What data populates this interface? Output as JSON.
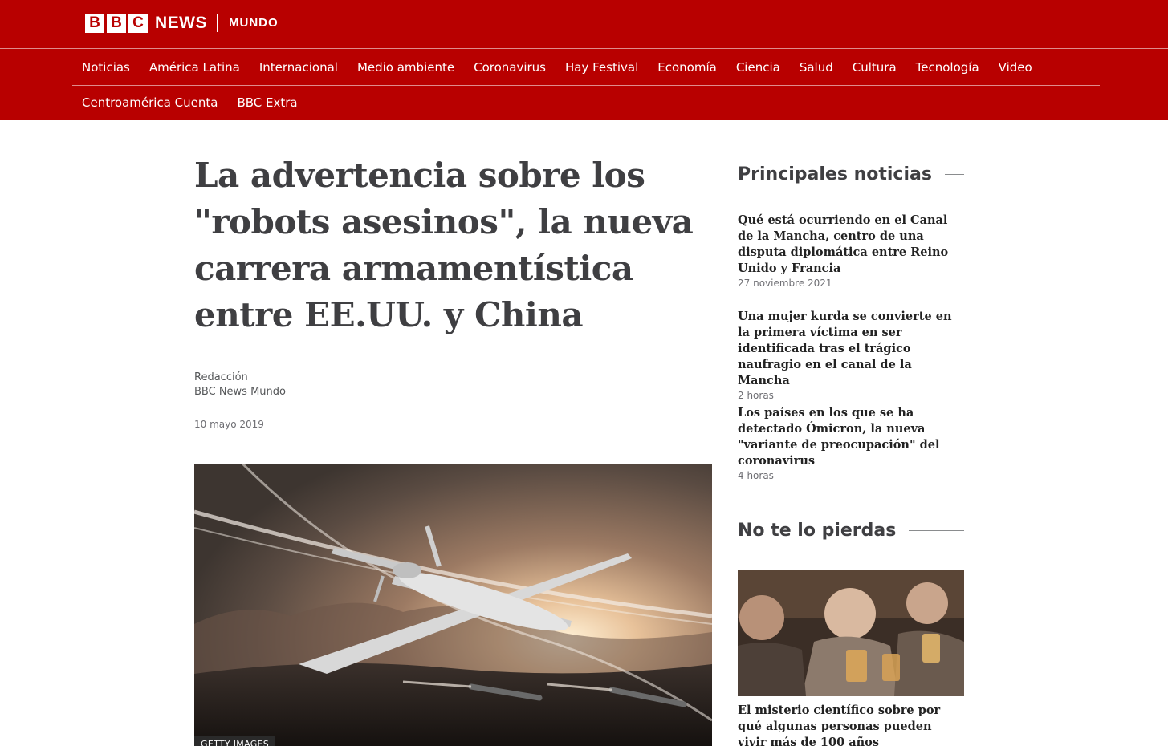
{
  "brand": {
    "letters": [
      "B",
      "B",
      "C"
    ],
    "news": "NEWS",
    "edition": "MUNDO"
  },
  "nav": {
    "row1": [
      "Noticias",
      "América Latina",
      "Internacional",
      "Medio ambiente",
      "Coronavirus",
      "Hay Festival",
      "Economía",
      "Ciencia",
      "Salud",
      "Cultura",
      "Tecnología",
      "Video"
    ],
    "row2": [
      "Centroamérica Cuenta",
      "BBC Extra"
    ]
  },
  "article": {
    "headline": "La advertencia sobre los \"robots asesinos\", la nueva carrera armamentística entre EE.UU. y China",
    "byline_role": "Redacción",
    "byline_org": "BBC News Mundo",
    "date": "10 mayo 2019",
    "image_credit": "GETTY IMAGES"
  },
  "sidebar": {
    "top_title": "Principales noticias",
    "top_stories": [
      {
        "title": "Qué está ocurriendo en el Canal de la Mancha, centro de una disputa diplomática entre Reino Unido y Francia",
        "time": "27 noviembre 2021"
      },
      {
        "title": "Una mujer kurda se convierte en la primera víctima en ser identificada tras el trágico naufragio en el canal de la Mancha",
        "time": "2 horas"
      },
      {
        "title": "Los países en los que se ha detectado Ómicron, la nueva \"variante de preocupación\" del coronavirus",
        "time": "4 horas"
      }
    ],
    "dont_miss_title": "No te lo pierdas",
    "promo_title": "El misterio científico sobre por qué algunas personas pueden vivir más de 100 años"
  },
  "colors": {
    "brand_red": "#b80000",
    "text": "#3f3f42"
  }
}
